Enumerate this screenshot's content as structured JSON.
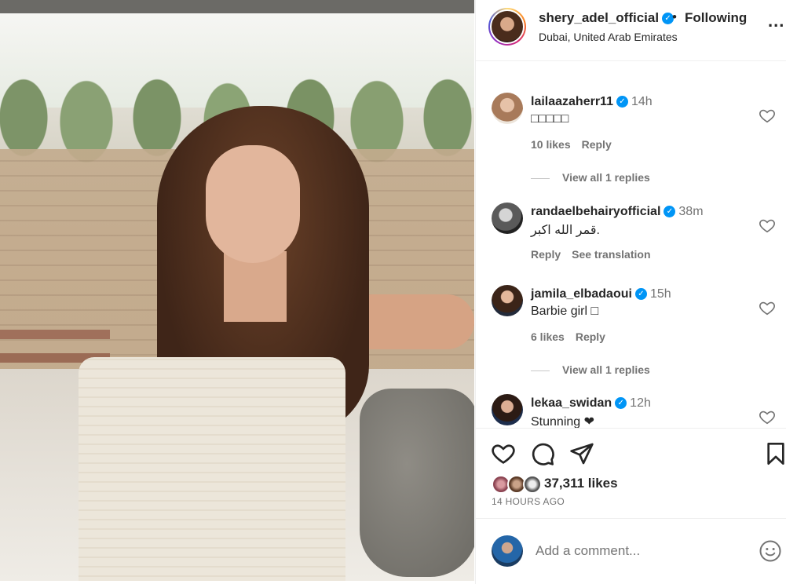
{
  "post": {
    "username": "shery_adel_official",
    "separator": "•",
    "follow_label": "Following",
    "location": "Dubai, United Arab Emirates",
    "more_label": "..."
  },
  "comments": [
    {
      "username": "lailaazaherr11",
      "time": "14h",
      "text": "□□□□□",
      "likes": "10 likes",
      "reply": "Reply",
      "view_replies": "View all 1 replies"
    },
    {
      "username": "randaelbehairyofficial",
      "time": "38m",
      "text": "قمر الله اكبر.",
      "reply": "Reply",
      "translate": "See translation"
    },
    {
      "username": "jamila_elbadaoui",
      "time": "15h",
      "text": "Barbie girl □",
      "likes": "6 likes",
      "reply": "Reply",
      "view_replies": "View all 1 replies"
    },
    {
      "username": "lekaa_swidan",
      "time": "12h",
      "text": "Stunning ❤"
    }
  ],
  "engagement": {
    "likes": "37,311 likes",
    "time_ago": "14 HOURS AGO"
  },
  "composer": {
    "placeholder": "Add a comment..."
  },
  "icons": {
    "verified": "verified-badge-icon",
    "like": "heart-icon",
    "comment": "comment-bubble-icon",
    "share": "paper-plane-icon",
    "save": "bookmark-icon",
    "emoji": "smiley-icon"
  },
  "colors": {
    "verified_blue": "#0095f6",
    "muted_text": "#737373",
    "primary_text": "#262626"
  }
}
